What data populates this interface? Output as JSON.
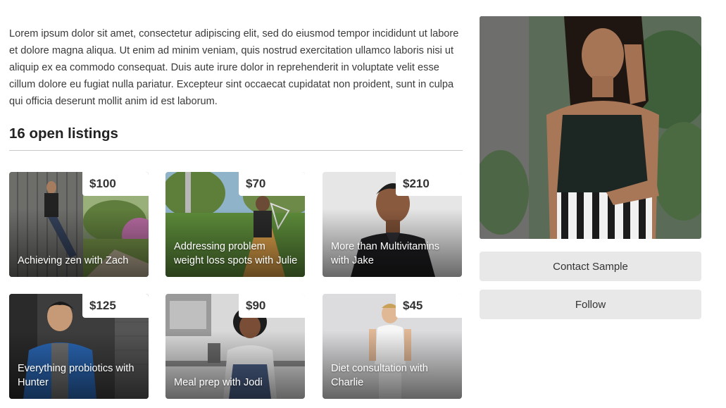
{
  "profile": {
    "bio": "Lorem ipsum dolor sit amet, consectetur adipiscing elit, sed do eiusmod tempor incididunt ut labore et dolore magna aliqua. Ut enim ad minim veniam, quis nostrud exercitation ullamco laboris nisi ut aliquip ex ea commodo consequat. Duis aute irure dolor in reprehenderit in voluptate velit esse cillum dolore eu fugiat nulla pariatur. Excepteur sint occaecat cupidatat non proident, sunt in culpa qui officia deserunt mollit anim id est laborum."
  },
  "listings": {
    "heading": "16 open listings",
    "items": [
      {
        "price": "$100",
        "title": "Achieving zen with Zach"
      },
      {
        "price": "$70",
        "title": "Addressing problem weight loss spots with Julie"
      },
      {
        "price": "$210",
        "title": "More than Multivitamins with Jake"
      },
      {
        "price": "$125",
        "title": "Everything probiotics with Hunter"
      },
      {
        "price": "$90",
        "title": "Meal prep with Jodi"
      },
      {
        "price": "$45",
        "title": "Diet consultation with Charlie"
      }
    ]
  },
  "sidebar": {
    "contact_label": "Contact Sample",
    "follow_label": "Follow"
  }
}
